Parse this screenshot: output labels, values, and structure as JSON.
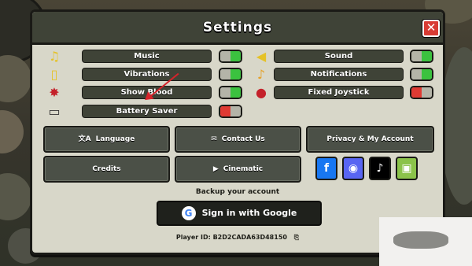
{
  "settings": {
    "title": "Settings",
    "close_icon": "close-icon",
    "left_toggles": [
      {
        "label": "Music",
        "icon": "music-icon",
        "on": true
      },
      {
        "label": "Vibrations",
        "icon": "vibration-icon",
        "on": true
      },
      {
        "label": "Show Blood",
        "icon": "blood-icon",
        "on": true
      },
      {
        "label": "Battery Saver",
        "icon": "battery-icon",
        "on": false
      }
    ],
    "right_toggles": [
      {
        "label": "Sound",
        "icon": "speaker-icon",
        "on": true
      },
      {
        "label": "Notifications",
        "icon": "bell-icon",
        "on": true
      },
      {
        "label": "Fixed Joystick",
        "icon": "joystick-icon",
        "on": false
      }
    ],
    "buttons": {
      "language": "Language",
      "contact": "Contact Us",
      "privacy": "Privacy & My Account",
      "credits": "Credits",
      "cinematic": "Cinematic"
    },
    "social_icons": [
      "facebook-icon",
      "discord-icon",
      "tiktok-icon",
      "game-controller-icon"
    ],
    "social_colors": {
      "facebook": "#1877f2",
      "discord": "#5865f2",
      "tiktok": "#000000",
      "game": "#8bc34a"
    },
    "backup_label": "Backup your account",
    "google_label": "Sign in with Google",
    "player_id": "Player ID: B2D2CADA63D48150"
  }
}
